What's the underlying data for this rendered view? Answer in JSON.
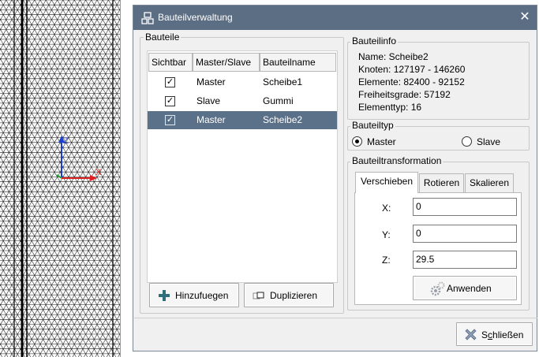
{
  "dialog": {
    "title": "Bauteilverwaltung",
    "close_glyph": "✕"
  },
  "parts": {
    "group_title": "Bauteile",
    "columns": [
      "Sichtbar",
      "Master/Slave",
      "Bauteilname"
    ],
    "rows": [
      {
        "visible": true,
        "role": "Master",
        "name": "Scheibe1",
        "selected": false
      },
      {
        "visible": true,
        "role": "Slave",
        "name": "Gummi",
        "selected": false
      },
      {
        "visible": true,
        "role": "Master",
        "name": "Scheibe2",
        "selected": true
      }
    ],
    "check_glyph": "✓",
    "add_label": "Hinzufuegen",
    "duplicate_label": "Duplizieren"
  },
  "info": {
    "group_title": "Bauteilinfo",
    "lines": [
      "Name: Scheibe2",
      "Knoten: 127197 - 146260",
      "Elemente: 82400 - 92152",
      "Freiheitsgrade: 57192",
      "Elementtyp: 16"
    ]
  },
  "type": {
    "group_title": "Bauteiltyp",
    "master_label": "Master",
    "slave_label": "Slave",
    "selected": "Master"
  },
  "transform": {
    "group_title": "Bauteiltransformation",
    "tabs": [
      "Verschieben",
      "Rotieren",
      "Skalieren"
    ],
    "active_tab": "Verschieben",
    "x_label": "X:",
    "y_label": "Y:",
    "z_label": "Z:",
    "x_value": "0",
    "y_value": "0",
    "z_value": "29.5",
    "apply_label": "Anwenden"
  },
  "footer": {
    "close_label_prefix": "S",
    "close_label_mnemonic": "c",
    "close_label_suffix": "hließen"
  },
  "viewport": {
    "axis_labels": [
      "Z",
      "X"
    ]
  },
  "colors": {
    "titlebar": "#5c6e84",
    "selection": "#5b7189",
    "axis_z": "#1c3fd1",
    "axis_x": "#e02020",
    "axis_y": "#1fa33a"
  }
}
